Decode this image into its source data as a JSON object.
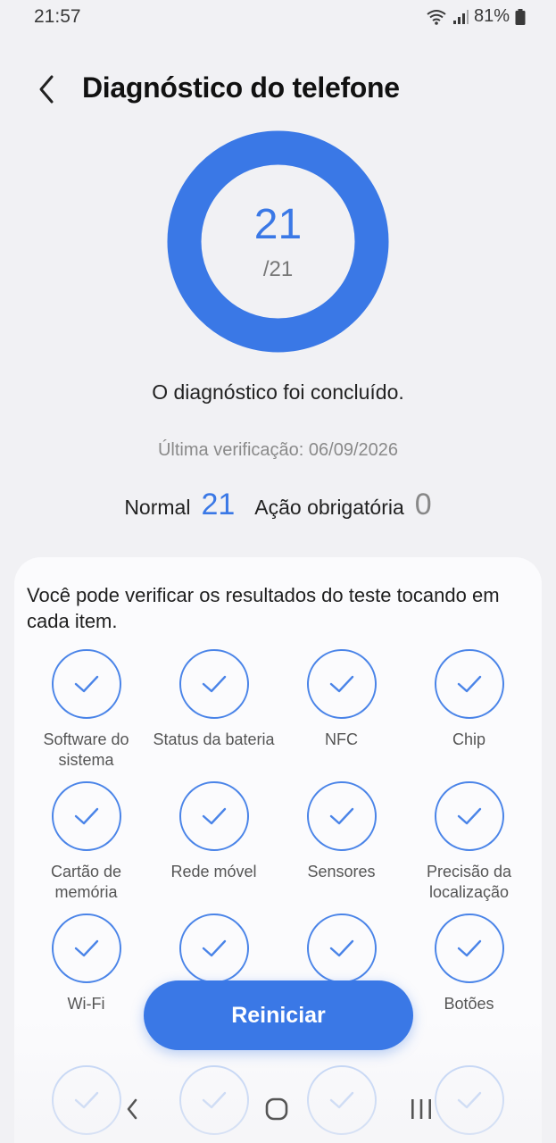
{
  "status_bar": {
    "time": "21:57",
    "battery": "81%"
  },
  "header": {
    "title": "Diagnóstico do telefone"
  },
  "score": {
    "passed": "21",
    "total": "/21",
    "progress_fraction": 1.0
  },
  "message": "O diagnóstico foi concluído.",
  "last_check": "Última verificação: 06/09/2026",
  "summary": {
    "normal_label": "Normal",
    "normal_value": "21",
    "action_label": "Ação obrigatória",
    "action_value": "0"
  },
  "card": {
    "instruction": "Você pode verificar os resultados do teste tocando em cada item.",
    "items": [
      {
        "label": "Software do sistema"
      },
      {
        "label": "Status da bateria"
      },
      {
        "label": "NFC"
      },
      {
        "label": "Chip"
      },
      {
        "label": "Cartão de memória"
      },
      {
        "label": "Rede móvel"
      },
      {
        "label": "Sensores"
      },
      {
        "label": "Precisão da localização"
      },
      {
        "label": "Wi-Fi"
      },
      {
        "label": ""
      },
      {
        "label": ""
      },
      {
        "label": "Botões"
      }
    ]
  },
  "restart_button": {
    "label": "Reiniciar"
  },
  "colors": {
    "accent": "#3a78e6",
    "background": "#f1f1f4",
    "card": "#fbfbfd"
  },
  "icons": {
    "back": "chevron-left-icon",
    "check": "check-icon",
    "nav_back": "nav-back-icon",
    "nav_home": "nav-home-icon",
    "nav_recents": "nav-recents-icon"
  }
}
